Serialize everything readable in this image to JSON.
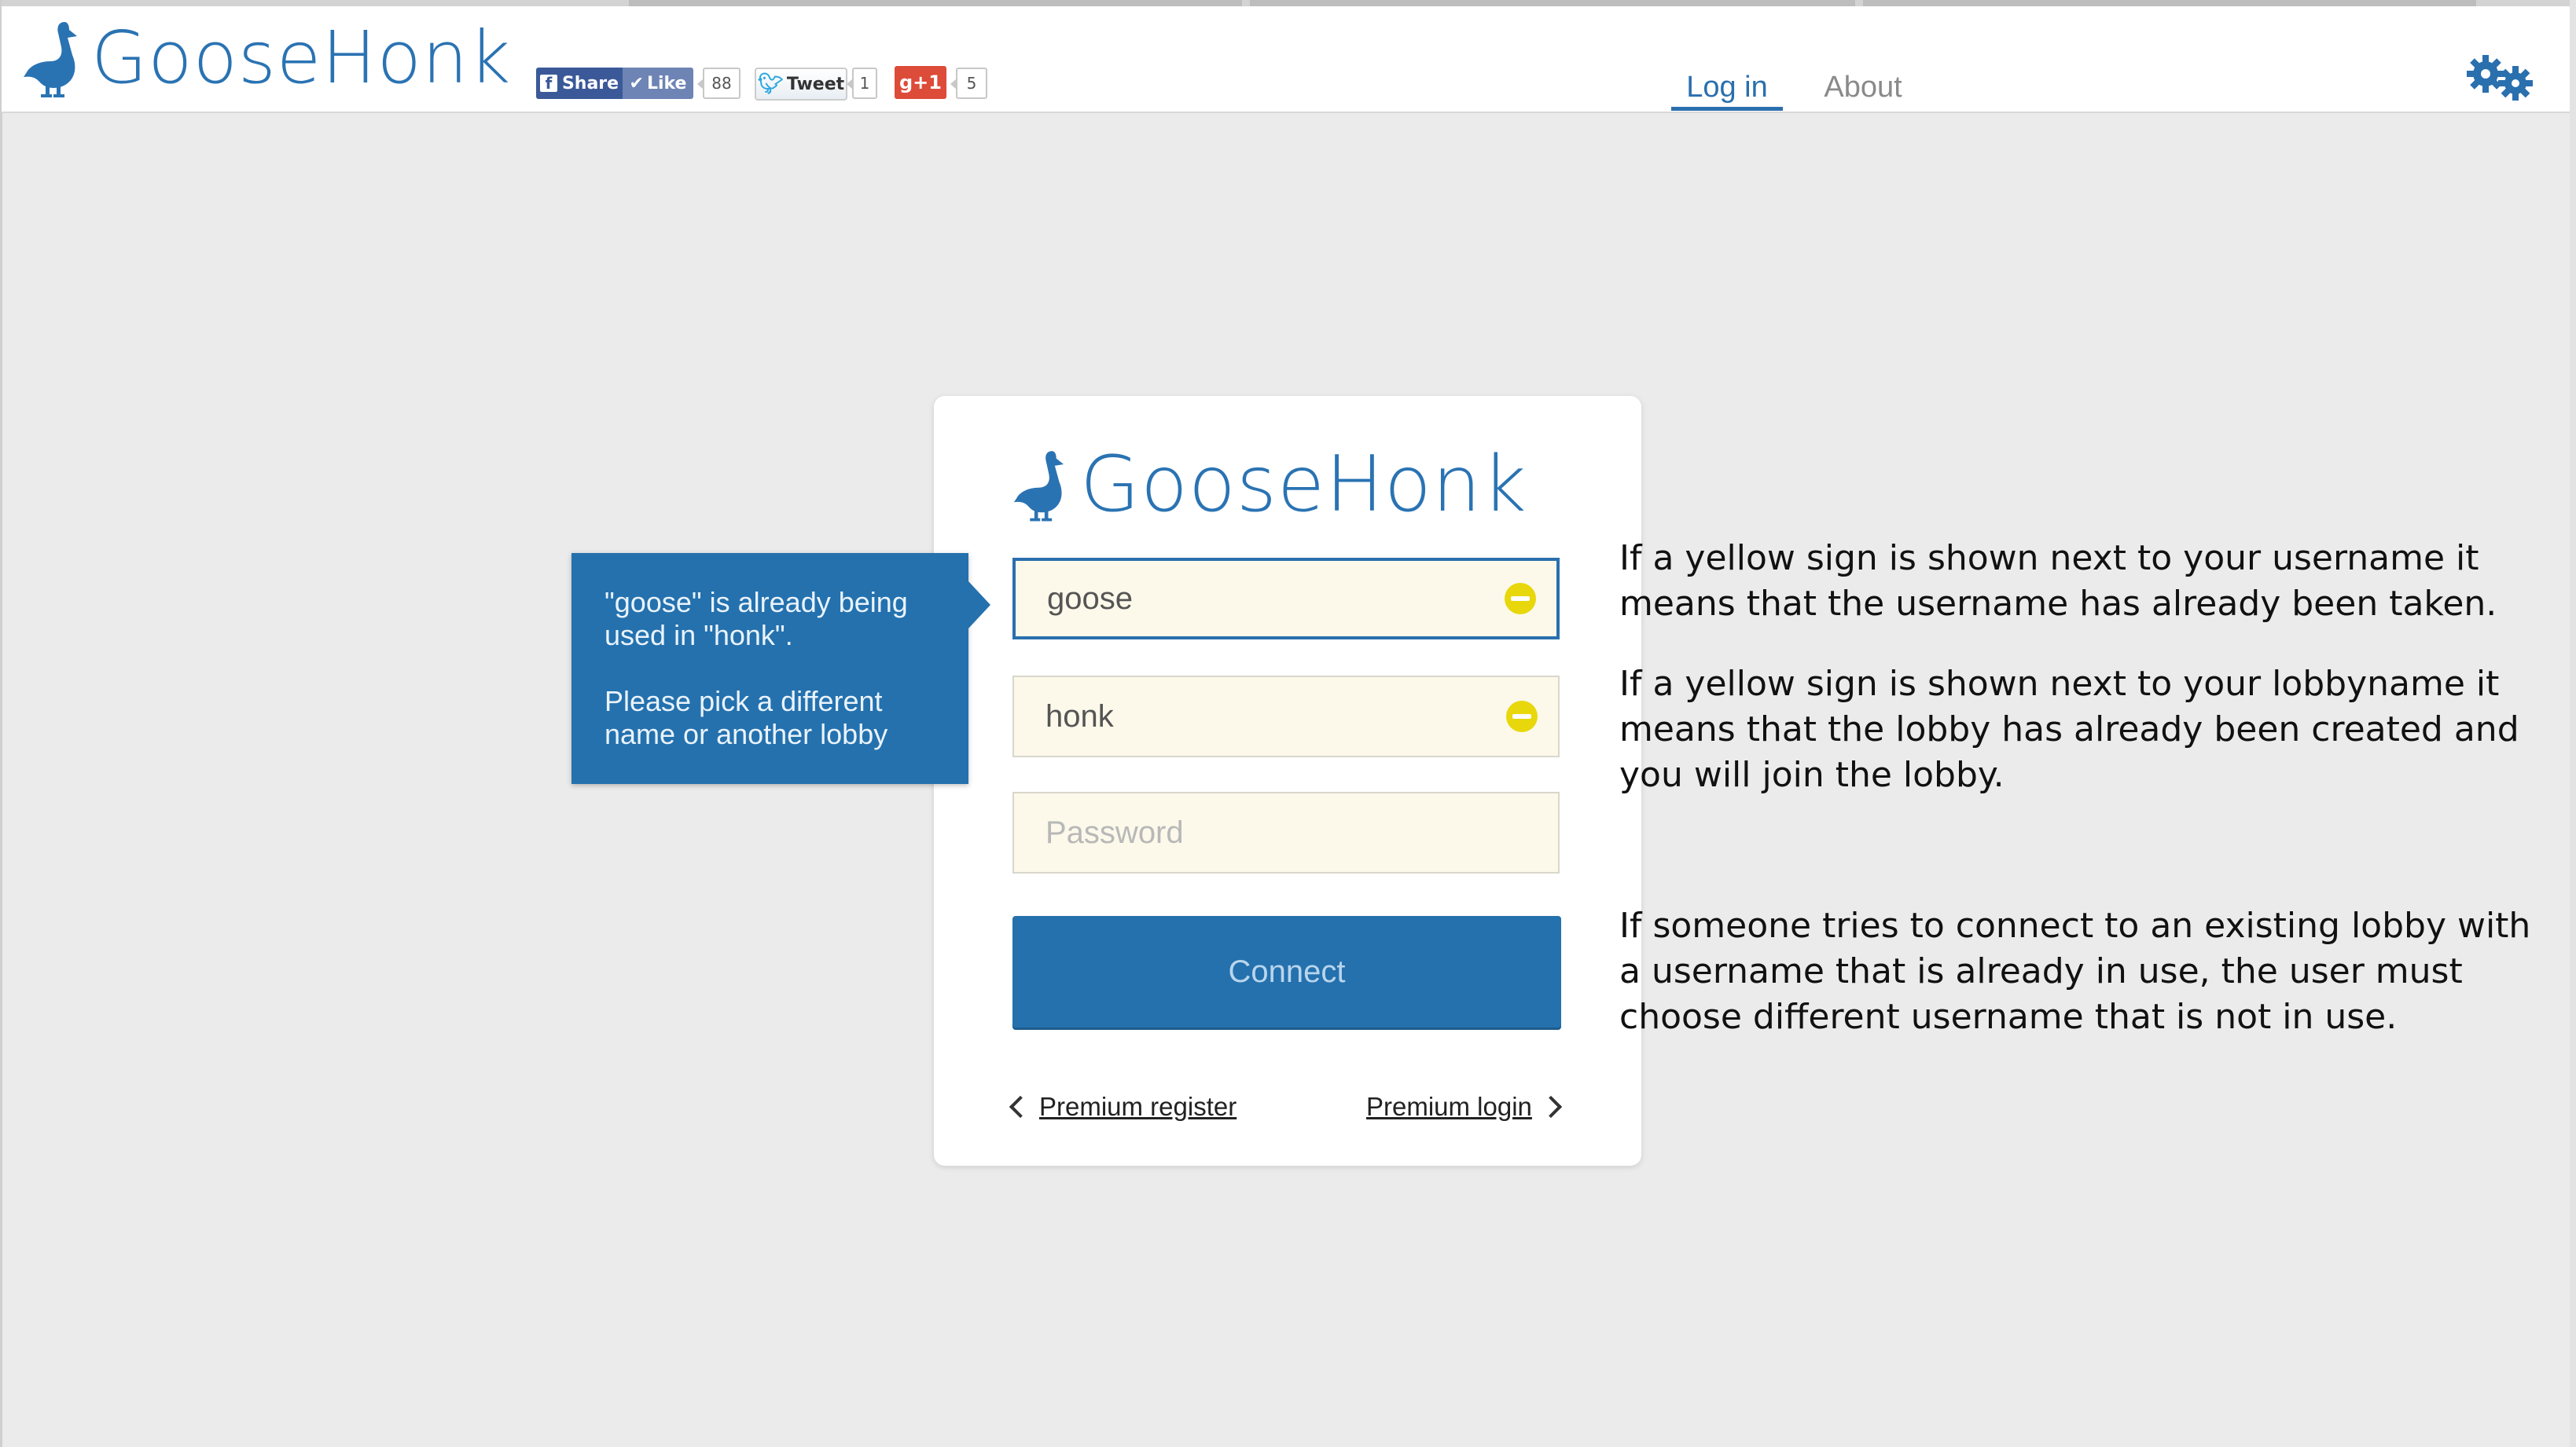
{
  "brand": {
    "name": "GooseHonk",
    "color": "#2a73b3"
  },
  "social": {
    "fb_share_label": "Share",
    "fb_like_label": "Like",
    "fb_like_count": "88",
    "tweet_label": "Tweet",
    "tweet_count": "1",
    "gplus_label": "g+1",
    "gplus_count": "5"
  },
  "nav": {
    "items": [
      {
        "label": "Log in",
        "active": true
      },
      {
        "label": "About",
        "active": false
      }
    ],
    "settings_icon": "gears-icon"
  },
  "form": {
    "username_value": "goose",
    "lobby_value": "honk",
    "password_placeholder": "Password",
    "connect_label": "Connect",
    "premium_register_label": "Premium register",
    "premium_login_label": "Premium login",
    "warning_color": "#e8d70a"
  },
  "tooltip": {
    "line1": "\"goose\" is already being used in \"honk\".",
    "line2": "Please pick a different name or another lobby"
  },
  "annotations": [
    "If a yellow sign is shown next to your username it means that the username has already been taken.",
    "If a yellow sign is shown next to your lobbyname it means that the lobby has already been created and you will join the lobby.",
    "If someone tries to connect to an existing lobby with a username that is already in use, the user must choose different username that is not in use."
  ],
  "colors": {
    "primary": "#2471ae",
    "field_bg": "#fcf9ea",
    "page_bg": "#ebebeb"
  }
}
